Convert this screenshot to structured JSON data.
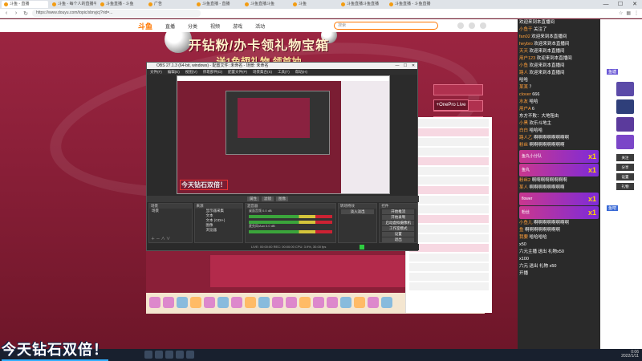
{
  "browser": {
    "tabs": [
      {
        "label": "斗鱼 - 直播"
      },
      {
        "label": "斗鱼 - 每个人的直播平台"
      },
      {
        "label": "斗鱼直播 - 斗鱼"
      },
      {
        "label": "广告"
      },
      {
        "label": "斗鱼直播 - 直播"
      },
      {
        "label": "斗鱼直播斗鱼"
      },
      {
        "label": "斗鱼"
      },
      {
        "label": "斗鱼直播斗鱼直播"
      },
      {
        "label": "斗鱼直播 - 斗鱼直播"
      }
    ],
    "url": "https://www.douyu.com/topic/sbnyjcj?rid=...",
    "win_min": "—",
    "win_max": "☐",
    "win_close": "✕"
  },
  "site": {
    "logo": "斗鱼",
    "nav": [
      "直播",
      "分类",
      "视频",
      "游戏",
      "活动"
    ],
    "search_placeholder": "搜索"
  },
  "banner": {
    "title": "开钻粉/办卡领礼物宝箱",
    "subtitle": "送1鱼翅礼物 领首抽",
    "buttons": [
      "",
      "",
      "",
      "+OnePro Live"
    ]
  },
  "obs": {
    "title": "OBS 27.1.3 (64-bit, windows) - 配置文件: 未命名 - 场景: 未命名",
    "menu": [
      "文件(F)",
      "编辑(E)",
      "视图(V)",
      "停靠部件(D)",
      "配置文件(P)",
      "场景集合(S)",
      "工具(T)",
      "帮助(H)"
    ],
    "scene_buttons": [
      "属性",
      "滤镜",
      "图像"
    ],
    "scenes_header": "场景",
    "scene_name": "场景",
    "sources_header": "来源",
    "sources": [
      "显示器采集",
      "文本",
      "文本 (GDI+)",
      "图像",
      "浏览器"
    ],
    "mixer_header": "混音器",
    "mixer_rows": [
      "桌面音频 0.0 dB",
      "麦克风/Aux 0.0 dB"
    ],
    "transitions_header": "转场特效",
    "transition_value": "淡入淡出",
    "controls_header": "控件",
    "controls": [
      "开始推流",
      "开始录制",
      "启动虚拟摄像机",
      "工作室模式",
      "设置",
      "退出"
    ],
    "status": "LIVE: 00:00:00  REC: 00:00:00  CPU: 3.9%, 30.00 fps",
    "preview_ticker": "今天钻石双倍！"
  },
  "chat": {
    "lines": [
      {
        "user": "",
        "text": "欢迎来到本直播间"
      },
      {
        "user": "小鱼干",
        "text": "关注了"
      },
      {
        "user": "fan02",
        "text": "欢迎来到本直播间"
      },
      {
        "user": "heybro",
        "text": "欢迎来到本直播间"
      },
      {
        "user": "天天",
        "text": "欢迎来到本直播间"
      },
      {
        "user": "用户123",
        "text": "欢迎来到本直播间"
      },
      {
        "user": "小鱼",
        "text": "欢迎来到本直播间"
      },
      {
        "user": "路人",
        "text": "欢迎来到本直播间"
      },
      {
        "user": "",
        "text": "哈哈"
      },
      {
        "user": "某某",
        "text": "？"
      },
      {
        "user": "clover",
        "text": "666"
      },
      {
        "user": "水友",
        "text": "哈哈"
      },
      {
        "user": "用户A",
        "text": "6"
      },
      {
        "user": "",
        "text": "东方不败：大地阻击"
      },
      {
        "user": "小黑",
        "text": "欢乐斗地主"
      },
      {
        "user": "白白",
        "text": "哈哈哈"
      },
      {
        "user": "路人乙",
        "text": "啊啊啊啊啊啊啊啊"
      },
      {
        "user": "粉丝",
        "text": "啊啊啊啊啊啊啊啊"
      },
      {
        "user": "粉丝2",
        "text": "啊啊啊啊啊啊啊啊"
      },
      {
        "user": "某人",
        "text": "啊啊啊啊啊啊啊啊"
      },
      {
        "user": "小鱼儿",
        "text": "啊啊啊啊啊啊啊啊"
      },
      {
        "user": "鱼",
        "text": "啊啊啊啊啊啊啊啊"
      },
      {
        "user": "我要",
        "text": "哈哈哈哈"
      }
    ],
    "gifts": [
      {
        "user": "鱼丸小分队",
        "mult": "x1"
      },
      {
        "user": "鱼丸",
        "mult": "x1"
      },
      {
        "user": "flower",
        "mult": "x1"
      },
      {
        "user": "粉丝",
        "mult": "x1"
      }
    ],
    "tail_lines": [
      {
        "user": "",
        "text": "x50"
      },
      {
        "user": "",
        "text": "六元主播 送出 礼物x50"
      },
      {
        "user": "",
        "text": "x100"
      },
      {
        "user": "",
        "text": "六元 送出 礼物 x50"
      },
      {
        "user": "",
        "text": "开播"
      }
    ]
  },
  "strip": {
    "label": "鱼塘",
    "buttons": [
      "关注",
      "分享",
      "设置",
      "礼物"
    ],
    "tag": "鱼吧"
  },
  "overlay_ticker": "今天钻石双倍！",
  "taskbar": {
    "time": "0:06",
    "date": "2022/1/11"
  }
}
